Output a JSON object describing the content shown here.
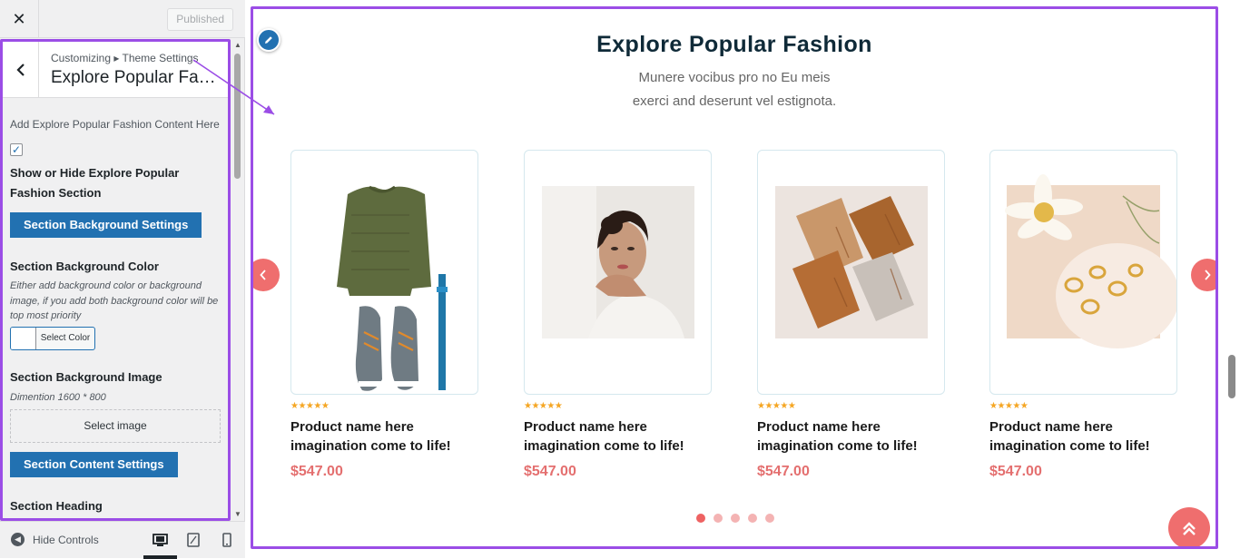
{
  "topbar": {
    "close_icon": "✕",
    "published_label": "Published"
  },
  "panel": {
    "breadcrumb": "Customizing ▸ Theme Settings",
    "title": "Explore Popular Fashion",
    "description": "Add Explore Popular Fashion Content Here",
    "checkbox_checked": true,
    "checkbox_label": "Show or Hide Explore Popular Fashion Section",
    "bg_settings_button": "Section Background Settings",
    "bg_color_label": "Section Background Color",
    "bg_color_note": "Either add background color or background image, if you add both background color will be top most priority",
    "select_color_label": "Select Color",
    "bg_image_label": "Section Background Image",
    "bg_image_note": "Dimention 1600 * 800",
    "select_image_label": "Select image",
    "content_settings_button": "Section Content Settings",
    "heading_label": "Section Heading"
  },
  "footer": {
    "hide_controls_label": "Hide Controls",
    "devices": [
      "desktop-icon",
      "tablet-icon",
      "mobile-icon"
    ],
    "active_device": "desktop"
  },
  "preview": {
    "title": "Explore Popular Fashion",
    "subtitle_line1": "Munere vocibus pro no Eu meis",
    "subtitle_line2": "exerci and deserunt vel estignota.",
    "products": [
      {
        "name": "Product name here imagination come to life!",
        "price": "$547.00",
        "rating": 5,
        "image": "sweater-shoes-belt"
      },
      {
        "name": "Product name here imagination come to life!",
        "price": "$547.00",
        "rating": 5,
        "image": "woman-portrait"
      },
      {
        "name": "Product name here imagination come to life!",
        "price": "$547.00",
        "rating": 5,
        "image": "folded-trousers"
      },
      {
        "name": "Product name here imagination come to life!",
        "price": "$547.00",
        "rating": 5,
        "image": "gold-rings-flower"
      }
    ],
    "stars_text": "★★★★★",
    "prev_icon": "‹",
    "next_icon": "›",
    "scroll_top_icon": "«",
    "dots_count": 5,
    "active_dot": 0
  },
  "colors": {
    "accent": "#ef6e6e",
    "price": "#e46f6f",
    "wp_blue": "#2271b1",
    "highlight_purple": "#9b4de6",
    "heading": "#0f2a38"
  }
}
